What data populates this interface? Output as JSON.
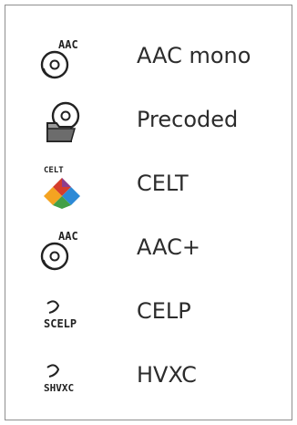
{
  "menu": {
    "items": [
      {
        "label": "AAC mono",
        "icon": "aac-disc-icon",
        "icon_text": "AAC"
      },
      {
        "label": "Precoded",
        "icon": "folder-disc-icon"
      },
      {
        "label": "CELT",
        "icon": "celt-diamond-icon",
        "icon_text": "CELT"
      },
      {
        "label": "AAC+",
        "icon": "aac-disc-icon",
        "icon_text": "AAC"
      },
      {
        "label": "CELP",
        "icon": "celp-speech-icon",
        "icon_text": "SCELP"
      },
      {
        "label": "HVXC",
        "icon": "hvxc-speech-icon",
        "icon_text": "SHVXC"
      }
    ]
  }
}
